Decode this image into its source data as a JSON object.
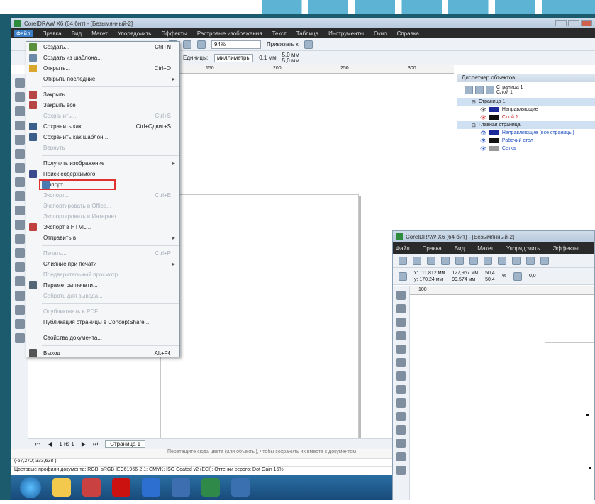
{
  "win1": {
    "title": "CorelDRAW X6 (64 бит) - [Безымянный-2]",
    "menu": [
      "Файл",
      "Правка",
      "Вид",
      "Макет",
      "Упорядочить",
      "Эффекты",
      "Растровые изображения",
      "Текст",
      "Таблица",
      "Инструменты",
      "Окно",
      "Справка"
    ],
    "toolbar": {
      "zoom": "94%",
      "snap": "Привязать к",
      "units_label": "Единицы:",
      "units_value": "миллиметры",
      "nudge": "0,1 мм",
      "dup1": "5,0 мм",
      "dup2": "5,0 мм"
    },
    "file_menu": [
      {
        "label": "Создать...",
        "shortcut": "Ctrl+N",
        "disabled": false,
        "sep": false,
        "sub": false,
        "highlight": false,
        "icon": "new-doc-icon",
        "color": "#5a8f3c"
      },
      {
        "label": "Создать из шаблона...",
        "shortcut": "",
        "disabled": false,
        "sep": false,
        "sub": false,
        "highlight": false,
        "icon": "template-icon",
        "color": "#6a8aa8"
      },
      {
        "label": "Открыть...",
        "shortcut": "Ctrl+O",
        "disabled": false,
        "sep": false,
        "sub": false,
        "highlight": false,
        "icon": "open-folder-icon",
        "color": "#d9a62e"
      },
      {
        "label": "Открыть последние",
        "shortcut": "",
        "disabled": false,
        "sep": false,
        "sub": true,
        "highlight": false,
        "icon": "",
        "color": ""
      },
      {
        "label": "Закрыть",
        "shortcut": "",
        "disabled": false,
        "sep": true,
        "sub": false,
        "highlight": false,
        "icon": "close-doc-icon",
        "color": "#b84545"
      },
      {
        "label": "Закрыть все",
        "shortcut": "",
        "disabled": false,
        "sep": false,
        "sub": false,
        "highlight": false,
        "icon": "close-all-icon",
        "color": "#b84545"
      },
      {
        "label": "Сохранить...",
        "shortcut": "Ctrl+S",
        "disabled": true,
        "sep": false,
        "sub": false,
        "highlight": false,
        "icon": "",
        "color": ""
      },
      {
        "label": "Сохранить как...",
        "shortcut": "Ctrl+Сдвиг+S",
        "disabled": false,
        "sep": false,
        "sub": false,
        "highlight": false,
        "icon": "save-as-icon",
        "color": "#3a5f8a"
      },
      {
        "label": "Сохранить как шаблон...",
        "shortcut": "",
        "disabled": false,
        "sep": false,
        "sub": false,
        "highlight": false,
        "icon": "save-template-icon",
        "color": "#3a5f8a"
      },
      {
        "label": "Вернуть",
        "shortcut": "",
        "disabled": true,
        "sep": false,
        "sub": false,
        "highlight": false,
        "icon": "",
        "color": ""
      },
      {
        "label": "Получить изображение",
        "shortcut": "",
        "disabled": false,
        "sep": true,
        "sub": true,
        "highlight": false,
        "icon": "",
        "color": ""
      },
      {
        "label": "Поиск содержимого",
        "shortcut": "",
        "disabled": false,
        "sep": false,
        "sub": false,
        "highlight": false,
        "icon": "search-content-icon",
        "color": "#3b4a8c"
      },
      {
        "label": "Импорт...",
        "shortcut": "Ctrl+I",
        "disabled": false,
        "sep": false,
        "sub": false,
        "highlight": true,
        "icon": "import-icon",
        "color": "#4a7ab0"
      },
      {
        "label": "Экспорт...",
        "shortcut": "Ctrl+E",
        "disabled": true,
        "sep": false,
        "sub": false,
        "highlight": false,
        "icon": "",
        "color": ""
      },
      {
        "label": "Экспортировать в Office...",
        "shortcut": "",
        "disabled": true,
        "sep": false,
        "sub": false,
        "highlight": false,
        "icon": "",
        "color": ""
      },
      {
        "label": "Экспортировать в Интернет...",
        "shortcut": "",
        "disabled": true,
        "sep": false,
        "sub": false,
        "highlight": false,
        "icon": "",
        "color": ""
      },
      {
        "label": "Экспорт в HTML...",
        "shortcut": "",
        "disabled": false,
        "sep": false,
        "sub": false,
        "highlight": false,
        "icon": "html-icon",
        "color": "#c04040"
      },
      {
        "label": "Отправить в",
        "shortcut": "",
        "disabled": false,
        "sep": false,
        "sub": true,
        "highlight": false,
        "icon": "",
        "color": ""
      },
      {
        "label": "Печать...",
        "shortcut": "Ctrl+P",
        "disabled": true,
        "sep": true,
        "sub": false,
        "highlight": false,
        "icon": "",
        "color": ""
      },
      {
        "label": "Слияние при печати",
        "shortcut": "",
        "disabled": false,
        "sep": false,
        "sub": true,
        "highlight": false,
        "icon": "",
        "color": ""
      },
      {
        "label": "Предварительный просмотр...",
        "shortcut": "",
        "disabled": true,
        "sep": false,
        "sub": false,
        "highlight": false,
        "icon": "",
        "color": ""
      },
      {
        "label": "Параметры печати...",
        "shortcut": "",
        "disabled": false,
        "sep": false,
        "sub": false,
        "highlight": false,
        "icon": "print-setup-icon",
        "color": "#556677"
      },
      {
        "label": "Собрать для вывода...",
        "shortcut": "",
        "disabled": true,
        "sep": false,
        "sub": false,
        "highlight": false,
        "icon": "",
        "color": ""
      },
      {
        "label": "Опубликовать в PDF...",
        "shortcut": "",
        "disabled": true,
        "sep": true,
        "sub": false,
        "highlight": false,
        "icon": "",
        "color": ""
      },
      {
        "label": "Публикация страницы в ConceptShare...",
        "shortcut": "",
        "disabled": false,
        "sep": false,
        "sub": false,
        "highlight": false,
        "icon": "",
        "color": ""
      },
      {
        "label": "Свойства документа...",
        "shortcut": "",
        "disabled": false,
        "sep": true,
        "sub": false,
        "highlight": false,
        "icon": "",
        "color": ""
      },
      {
        "label": "Выход",
        "shortcut": "Alt+F4",
        "disabled": false,
        "sep": true,
        "sub": false,
        "highlight": false,
        "icon": "exit-icon",
        "color": "#555"
      }
    ],
    "obj_manager": {
      "title": "Диспетчер объектов",
      "current_page": "Страница 1",
      "current_layer": "Слой 1",
      "rows": [
        {
          "text": "Страница 1",
          "cls": "sel",
          "sw": ""
        },
        {
          "text": "Направляющие",
          "cls": "sub",
          "sw": "#1a2a9a"
        },
        {
          "text": "Слой 1",
          "cls": "sub red",
          "sw": "#111"
        },
        {
          "text": "Главная страница",
          "cls": "sel",
          "sw": ""
        },
        {
          "text": "Направляющие (все страницы)",
          "cls": "sub blue",
          "sw": "#1a2a9a"
        },
        {
          "text": "Рабочий стол",
          "cls": "sub blue",
          "sw": "#111"
        },
        {
          "text": "Сетка",
          "cls": "sub blue",
          "sw": "#999"
        }
      ]
    },
    "ruler_ticks": [
      "50",
      "100",
      "150",
      "200",
      "250",
      "300"
    ],
    "pagebar": {
      "counter": "1 из 1",
      "tab": "Страница 1"
    },
    "hint": "Перетащите сюда цвета (или объекты), чтобы сохранить их вместе с документом",
    "status_coords": "(-57,270; 333,638 )",
    "status_profiles": "Цветовые профили документа: RGB: sRGB IEC61966-2.1; CMYK: ISO Coated v2 (ECI); Оттенки серого: Dot Gain 15%"
  },
  "taskbar_colors": [
    "#f2c94c",
    "#c94141",
    "#cc1111",
    "#2c6fd0",
    "#3d6fb0",
    "#2f8a4a",
    "#3a6fb0"
  ],
  "win2": {
    "title": "CorelDRAW X6 (64 бит) - [Безымянный-2]",
    "menu": [
      "Файл",
      "Правка",
      "Вид",
      "Макет",
      "Упорядочить",
      "Эффекты"
    ],
    "pos_x": "x: 111,812 мм",
    "pos_y": "y: 170,24 мм",
    "size_w": "127,967 мм",
    "size_h": "99,574 мм",
    "scale1": "50,4",
    "scale2": "50,4",
    "percent": "%",
    "angle": "0,0",
    "ruler_mark": "100"
  }
}
